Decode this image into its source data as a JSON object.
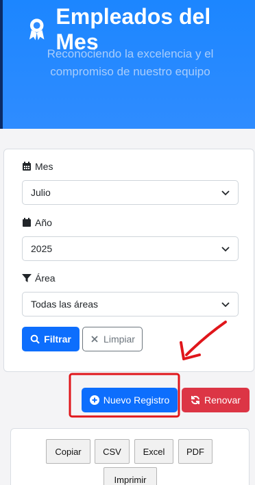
{
  "hero": {
    "title": "Empleados del Mes",
    "subtitle": "Reconociendo la excelencia y el compromiso de nuestro equipo",
    "icon": "award-icon"
  },
  "filters": {
    "month": {
      "label": "Mes",
      "value": "Julio",
      "icon": "calendar-days-icon"
    },
    "year": {
      "label": "Año",
      "value": "2025",
      "icon": "calendar-icon"
    },
    "area": {
      "label": "Área",
      "value": "Todas las áreas",
      "icon": "filter-icon"
    },
    "filter_button": "Filtrar",
    "clear_button": "Limpiar"
  },
  "actions": {
    "new_button": "Nuevo Registro",
    "renew_button": "Renovar"
  },
  "export": {
    "buttons": [
      "Copiar",
      "CSV",
      "Excel",
      "PDF",
      "Imprimir"
    ]
  },
  "colors": {
    "primary": "#0d6efd",
    "danger": "#dc3545",
    "hero": "#1c86ff",
    "annotation": "#e0161b"
  }
}
